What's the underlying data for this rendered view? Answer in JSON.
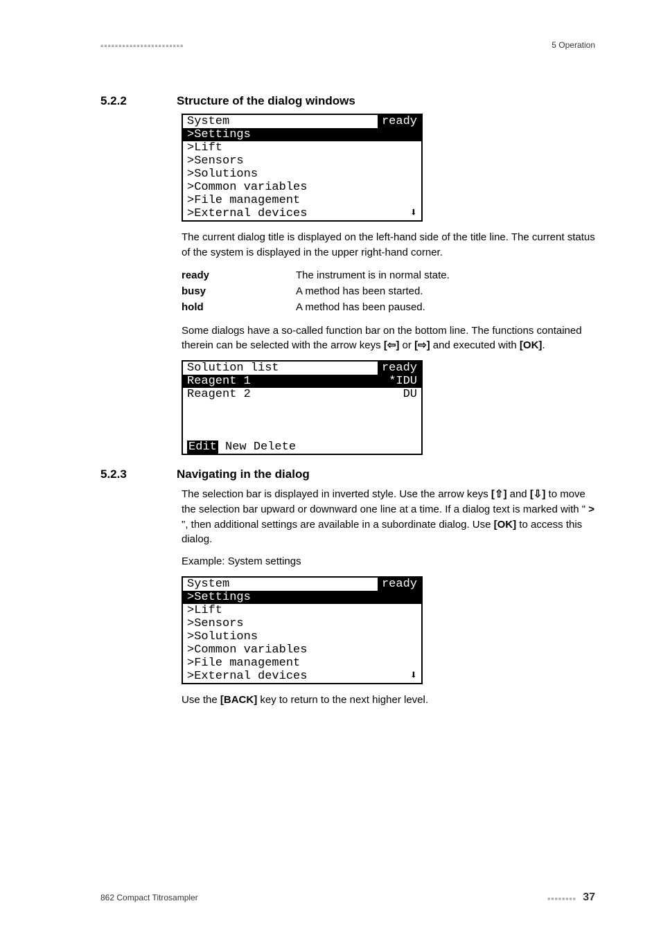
{
  "header": {
    "dots": "■■■■■■■■■■■■■■■■■■■■■■■",
    "right": "5 Operation"
  },
  "s522": {
    "num": "5.2.2",
    "title": "Structure of the dialog windows",
    "lcd1": {
      "title_left": "System",
      "title_right": "ready",
      "rows": [
        ">Settings",
        ">Lift",
        ">Sensors",
        ">Solutions",
        ">Common variables",
        ">File management",
        ">External devices"
      ],
      "arrow": "⬇"
    },
    "para1": "The current dialog title is displayed on the left-hand side of the title line. The current status of the system is displayed in the upper right-hand corner.",
    "defs": {
      "ready": {
        "term": "ready",
        "desc": "The instrument is in normal state."
      },
      "busy": {
        "term": "busy",
        "desc": "A method has been started."
      },
      "hold": {
        "term": "hold",
        "desc": "A method has been paused."
      }
    },
    "para2a": "Some dialogs have a so-called function bar on the bottom line. The functions contained therein can be selected with the arrow keys ",
    "keyL": "[⇦]",
    "para2_or": " or ",
    "keyR": "[⇨]",
    "para2b": " and executed with ",
    "keyOK": "[OK]",
    "para2c": ".",
    "lcd2": {
      "title_left": "Solution list",
      "title_right": "ready",
      "r1_left": "Reagent 1",
      "r1_right": "*IDU",
      "r2_left": "Reagent 2",
      "r2_right": "DU",
      "fn_sel": "Edit",
      "fn_rest": " New Delete"
    }
  },
  "s523": {
    "num": "5.2.3",
    "title": "Navigating in the dialog",
    "para1a": "The selection bar is displayed in inverted style. Use the arrow keys ",
    "keyUp": "[⇧]",
    "para1and": " and ",
    "keyDn": "[⇩]",
    "para1b": " to move the selection bar upward or downward one line at a time. If a dialog text is marked with \" ",
    "gt": ">",
    "para1c": " \", then additional settings are available in a subordinate dialog. Use ",
    "keyOK": "[OK]",
    "para1d": " to access this dialog.",
    "example": "Example: System settings",
    "lcd3": {
      "title_left": "System",
      "title_right": "ready",
      "rows": [
        ">Settings",
        ">Lift",
        ">Sensors",
        ">Solutions",
        ">Common variables",
        ">File management",
        ">External devices"
      ],
      "arrow": "⬇"
    },
    "para2a": "Use the ",
    "keyBack": "[BACK]",
    "para2b": " key to return to the next higher level."
  },
  "footer": {
    "left": "862 Compact Titrosampler",
    "dots": "■■■■■■■■",
    "page": "37"
  }
}
